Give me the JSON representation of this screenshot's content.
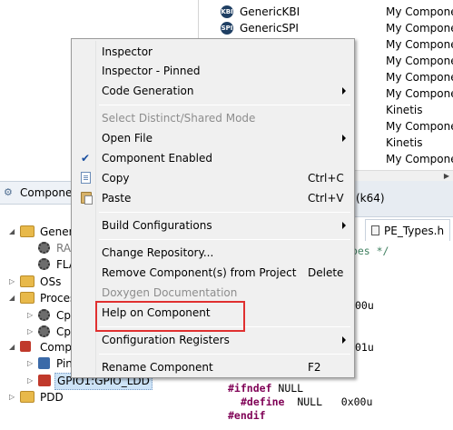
{
  "component_list": {
    "rows": [
      {
        "icon": "kbi-icon",
        "icon_text": "KBI",
        "name": "GenericKBI",
        "category": "My Compone"
      },
      {
        "icon": "spi-icon",
        "icon_text": "SPI",
        "name": "GenericSPI",
        "category": "My Compone"
      },
      {
        "category": "My Compone"
      },
      {
        "category": "My Compone"
      },
      {
        "category": "My Compone"
      },
      {
        "category": "My Compone"
      },
      {
        "category": "Kinetis"
      },
      {
        "category": "My Compone"
      },
      {
        "category": "Kinetis"
      },
      {
        "category": "My Compone"
      }
    ]
  },
  "components_panel": {
    "title": "Componen",
    "tree": [
      {
        "label": "Genera",
        "icon": "folder-icon",
        "twisty": "expanded"
      },
      {
        "label": "RA",
        "icon": "cog-icon"
      },
      {
        "label": "FLA",
        "icon": "cog-icon"
      },
      {
        "label": "OSs",
        "icon": "folder-icon",
        "twisty": "collapsed"
      },
      {
        "label": "Proces",
        "icon": "folder-icon",
        "twisty": "expanded"
      },
      {
        "label": "Cp",
        "icon": "cpu-icon",
        "twisty": "collapsed"
      },
      {
        "label": "Cp",
        "icon": "cpu-icon",
        "twisty": "collapsed"
      },
      {
        "label": "Comp",
        "icon": "folder-icon",
        "twisty": "expanded"
      },
      {
        "label": "Pin",
        "icon": "pin-icon",
        "twisty": "collapsed"
      },
      {
        "label": "GPIO1:GPIO_LDD",
        "icon": "chip-icon",
        "twisty": "collapsed"
      },
      {
        "label": "PDD",
        "icon": "folder-icon",
        "twisty": "collapsed"
      }
    ]
  },
  "editor": {
    "tab_k64": "(k64)",
    "file_tab": "PE_Types.h",
    "lines": {
      "types_comment": "ypes */",
      "val1": "00u",
      "val2": "01u",
      "ifndef_kw": "#ifndef",
      "ifndef_arg": " NULL",
      "define_kw": "#define",
      "define_arg": "  NULL   0x00u",
      "endif_kw": "#endif"
    }
  },
  "context_menu": {
    "items": [
      {
        "label": "Inspector"
      },
      {
        "label": "Inspector - Pinned"
      },
      {
        "label": "Code Generation",
        "submenu": true
      },
      {
        "label": "Select Distinct/Shared Mode",
        "disabled": true
      },
      {
        "label": "Open File",
        "submenu": true
      },
      {
        "label": "Component Enabled",
        "checked": true
      },
      {
        "label": "Copy",
        "accelerator": "Ctrl+C",
        "icon": "copy-icon"
      },
      {
        "label": "Paste",
        "accelerator": "Ctrl+V",
        "icon": "paste-icon"
      },
      {
        "label": "Build Configurations",
        "submenu": true
      },
      {
        "label": "Change Repository..."
      },
      {
        "label": "Remove Component(s) from Project",
        "accelerator": "Delete"
      },
      {
        "label": "Doxygen Documentation",
        "disabled": true
      },
      {
        "label": "Help on Component"
      },
      {
        "label": "Configuration Registers",
        "submenu": true
      },
      {
        "label": "Rename Component",
        "accelerator": "F2"
      }
    ]
  },
  "colors": {
    "highlight_border": "#e03030",
    "check_mark": "#1a4fa0",
    "disabled_text": "#8d8d8d"
  }
}
